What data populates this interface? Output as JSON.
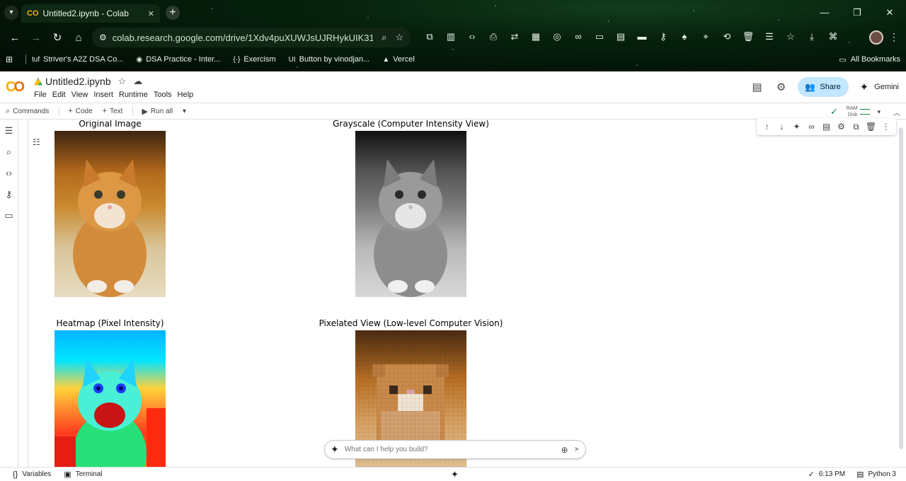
{
  "browser": {
    "tab_title": "Untitled2.ipynb - Colab",
    "url": "colab.research.google.com/drive/1Xdv4puXUWJsUJRHykUIK31A8x...",
    "bookmarks": [
      {
        "icon": "tuf-icon",
        "label": "Striver's A2Z DSA Co..."
      },
      {
        "icon": "globe-icon",
        "label": "DSA Practice - Inter..."
      },
      {
        "icon": "exercism-icon",
        "label": "Exercism"
      },
      {
        "icon": "ui-icon",
        "label": "Button by vinodjan..."
      },
      {
        "icon": "vercel-icon",
        "label": "Vercel"
      }
    ],
    "all_bookmarks": "All Bookmarks"
  },
  "colab": {
    "logo": "CO",
    "notebook_title": "Untitled2.ipynb",
    "menu": [
      "File",
      "Edit",
      "View",
      "Insert",
      "Runtime",
      "Tools",
      "Help"
    ],
    "share_label": "Share",
    "gemini_label": "Gemini",
    "toolbar": {
      "commands": "Commands",
      "code": "Code",
      "text": "Text",
      "run_all": "Run all",
      "ram": "RAM",
      "disk": "Disk"
    }
  },
  "output": {
    "panels": [
      {
        "title": "Original Image"
      },
      {
        "title": "Grayscale (Computer Intensity View)"
      },
      {
        "title": "Heatmap (Pixel Intensity)"
      },
      {
        "title": "Pixelated View (Low-level Computer Vision)"
      }
    ]
  },
  "prompt": {
    "placeholder": "What can I help you build?"
  },
  "statusbar": {
    "variables": "Variables",
    "terminal": "Terminal",
    "time": "6:13 PM",
    "kernel": "Python 3"
  },
  "colors": {
    "share_bg": "#c2e7ff",
    "logo_orange": "#f9ab00",
    "check_green": "#188038"
  }
}
